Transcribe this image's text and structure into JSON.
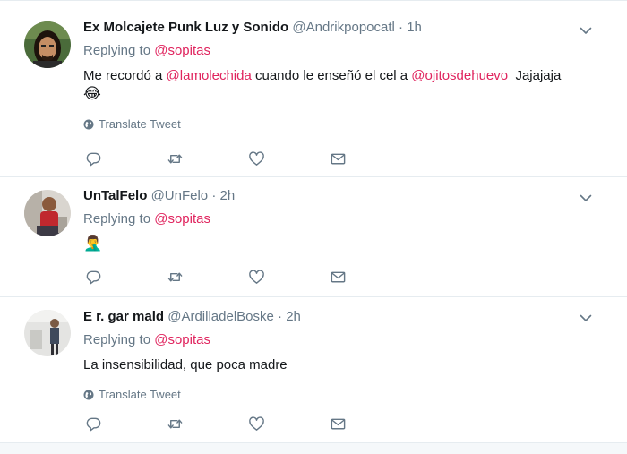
{
  "tweets": [
    {
      "fullname": "Ex Molcajete Punk Luz y Sonido",
      "screen_name": "@Andrikpopocatl",
      "sep": "·",
      "time": "1h",
      "replying_prefix": "Replying to",
      "replying_to": "@sopitas",
      "text_parts": [
        "Me recordó a ",
        "@lamolechida",
        " cuando le enseñó el cel a ",
        "@ojitosdehuevo",
        "  Jajajaja"
      ],
      "emoji": "😂",
      "translate_label": "Translate Tweet"
    },
    {
      "fullname": "UnTalFelo",
      "screen_name": "@UnFelo",
      "sep": "·",
      "time": "2h",
      "replying_prefix": "Replying to",
      "replying_to": "@sopitas",
      "emoji": "🤦‍♂️"
    },
    {
      "fullname": "E r. gar mald",
      "screen_name": "@ArdilladelBoske",
      "sep": "·",
      "time": "2h",
      "replying_prefix": "Replying to",
      "replying_to": "@sopitas",
      "text": "La insensibilidad, que poca madre",
      "translate_label": "Translate Tweet"
    }
  ],
  "icons": {
    "reply": "reply-icon",
    "retweet": "retweet-icon",
    "like": "heart-icon",
    "dm": "envelope-icon",
    "caret": "chevron-down-icon",
    "globe": "globe-icon"
  },
  "colors": {
    "mention": "#e0245e",
    "secondary_text": "#657786",
    "primary_text": "#14171a",
    "border": "#e6ecf0",
    "icon": "#657786"
  }
}
